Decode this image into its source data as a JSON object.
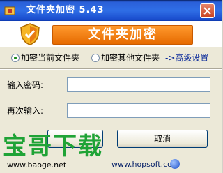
{
  "window": {
    "title": "文件夹加密  5.43"
  },
  "banner": {
    "title": "文件夹加密"
  },
  "options": {
    "encrypt_current": "加密当前文件夹",
    "encrypt_other": "加密其他文件夹",
    "advanced": "->高级设置",
    "selected": "encrypt_current"
  },
  "form": {
    "password_label": "输入密码:",
    "confirm_label": "再次输入:",
    "password_value": "",
    "confirm_value": ""
  },
  "buttons": {
    "cancel": "取消"
  },
  "footer": {
    "url": "www.hopsoft.com"
  },
  "watermark": {
    "brand": "宝哥下载",
    "url": "www.baoge.net"
  },
  "colors": {
    "titlebar": "#2f6ee6",
    "banner_orange": "#f08a1e",
    "watermark_green": "#1fa336"
  }
}
